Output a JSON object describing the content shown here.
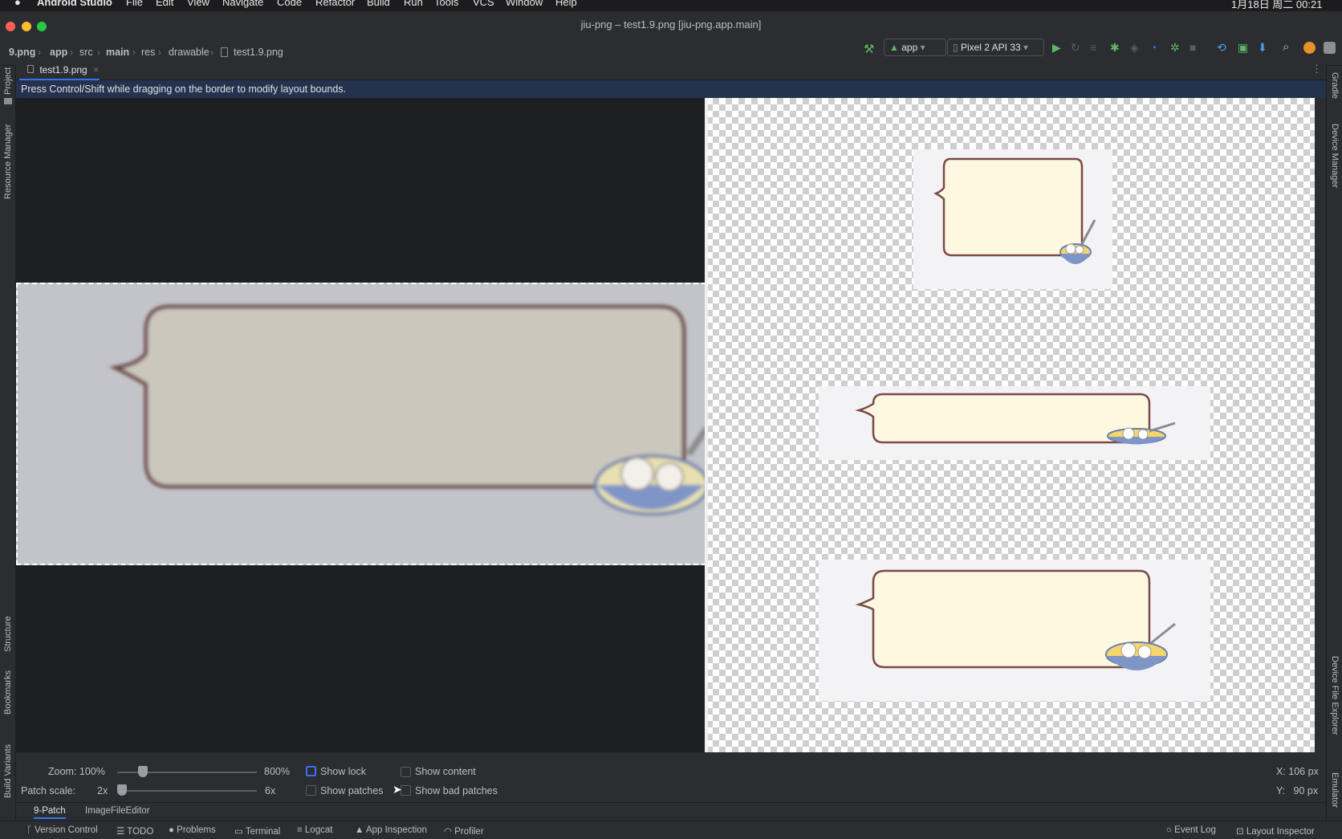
{
  "menubar": {
    "app_name": "Android Studio",
    "items": [
      "File",
      "Edit",
      "View",
      "Navigate",
      "Code",
      "Refactor",
      "Build",
      "Run",
      "Tools",
      "VCS",
      "Window",
      "Help"
    ],
    "clock": "1月18日 周二 00:21"
  },
  "window": {
    "title": "jiu-png – test1.9.png [jiu-png.app.main]"
  },
  "breadcrumb": [
    "9.png",
    "app",
    "src",
    "main",
    "res",
    "drawable",
    "test1.9.png"
  ],
  "toolbar": {
    "run_config": "app",
    "device": "Pixel 2 API 33"
  },
  "left_tools": [
    "Project",
    "Resource Manager",
    "Structure",
    "Bookmarks",
    "Build Variants"
  ],
  "right_tools": [
    "Gradle",
    "Device Manager",
    "Device File Explorer",
    "Emulator"
  ],
  "editor_tab": {
    "label": "test1.9.png"
  },
  "info_banner": "Press Control/Shift while dragging on the border to modify layout bounds.",
  "controls": {
    "zoom_label": "Zoom: 100%",
    "zoom_max": "800%",
    "zoom_level": 0.16,
    "patch_label": "Patch scale:",
    "patch_min": "2x",
    "patch_max": "6x",
    "patch_level": 0.0,
    "show_lock": "Show lock",
    "show_content": "Show content",
    "show_patches": "Show patches",
    "show_bad_patches": "Show bad patches",
    "coord_x": "X: 106 px",
    "coord_y": "Y:   90 px"
  },
  "editor_subtabs": [
    "9-Patch",
    "ImageFileEditor"
  ],
  "statusbar": {
    "left": [
      "Version Control",
      "TODO",
      "Problems",
      "Terminal",
      "Logcat",
      "App Inspection",
      "Profiler"
    ],
    "right": [
      "Event Log",
      "Layout Inspector"
    ]
  },
  "colors": {
    "accent": "#3574f0",
    "bubble_fill": "#fff8e1",
    "bubble_stroke": "#7a4a4a",
    "run_green": "#5fb865"
  }
}
